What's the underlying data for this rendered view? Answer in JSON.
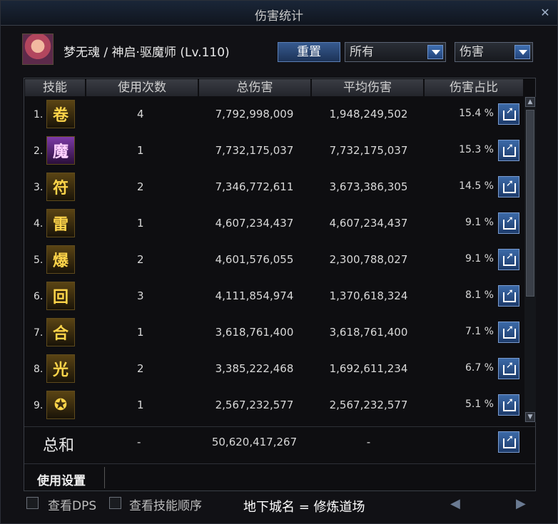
{
  "window": {
    "title": "伤害统计",
    "close": "✕"
  },
  "header": {
    "character": "梦无魂 / 神启·驱魔师 (Lv.110)",
    "reset_label": "重置",
    "filter1": "所有",
    "filter2": "伤害"
  },
  "columns": [
    "技能",
    "使用次数",
    "总伤害",
    "平均伤害",
    "伤害占比"
  ],
  "rows": [
    {
      "num": "1.",
      "icon": "scroll-icon",
      "glyph": "卷",
      "uses": "4",
      "total": "7,792,998,009",
      "avg": "1,948,249,502",
      "pct": "15.4 %"
    },
    {
      "num": "2.",
      "icon": "demon-face-icon",
      "glyph": "魔",
      "uses": "1",
      "total": "7,732,175,037",
      "avg": "7,732,175,037",
      "pct": "15.3 %"
    },
    {
      "num": "3.",
      "icon": "seal-talisman-icon",
      "glyph": "符",
      "uses": "2",
      "total": "7,346,772,611",
      "avg": "3,673,386,305",
      "pct": "14.5 %"
    },
    {
      "num": "4.",
      "icon": "lightning-burst-icon",
      "glyph": "雷",
      "uses": "1",
      "total": "4,607,234,437",
      "avg": "4,607,234,437",
      "pct": "9.1 %"
    },
    {
      "num": "5.",
      "icon": "explosion-icon",
      "glyph": "爆",
      "uses": "2",
      "total": "4,601,576,055",
      "avg": "2,300,788,027",
      "pct": "9.1 %"
    },
    {
      "num": "6.",
      "icon": "spiral-icon",
      "glyph": "回",
      "uses": "3",
      "total": "4,111,854,974",
      "avg": "1,370,618,324",
      "pct": "8.1 %"
    },
    {
      "num": "7.",
      "icon": "rune-circle-icon",
      "glyph": "合",
      "uses": "1",
      "total": "3,618,761,400",
      "avg": "3,618,761,400",
      "pct": "7.1 %"
    },
    {
      "num": "8.",
      "icon": "radiant-burst-icon",
      "glyph": "光",
      "uses": "2",
      "total": "3,385,222,468",
      "avg": "1,692,611,234",
      "pct": "6.7 %"
    },
    {
      "num": "9.",
      "icon": "pentagram-icon",
      "glyph": "✪",
      "uses": "1",
      "total": "2,567,232,577",
      "avg": "2,567,232,577",
      "pct": "5.1 %"
    }
  ],
  "summary": {
    "label": "总和",
    "uses": "-",
    "total": "50,620,417,267",
    "avg": "-"
  },
  "settings_label": "使用设置",
  "bottom": {
    "check_dps": "查看DPS",
    "check_order": "查看技能顺序",
    "dungeon": "地下城名 = 修炼道场",
    "prev": "◀",
    "next": "▶"
  },
  "colors": {
    "accent": "#3c6aa8",
    "text": "#d8d8d8"
  }
}
